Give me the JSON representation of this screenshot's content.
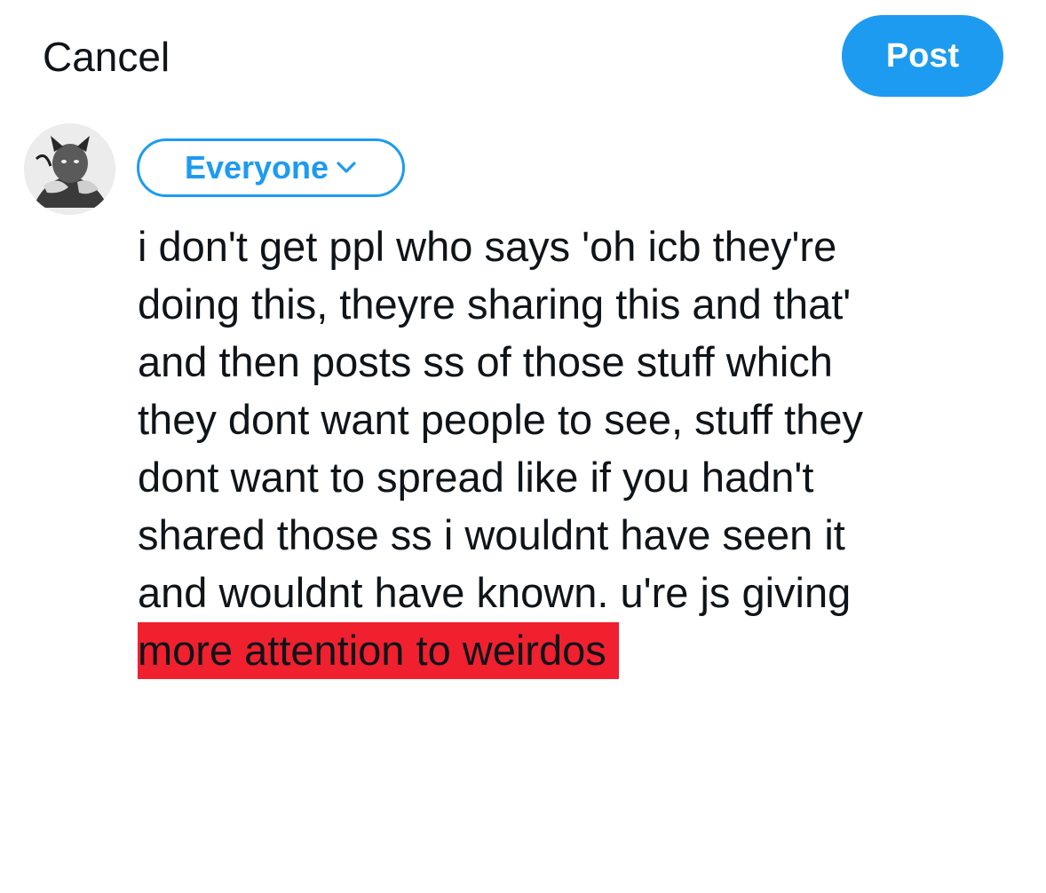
{
  "header": {
    "cancel_label": "Cancel",
    "post_label": "Post"
  },
  "colors": {
    "accent": "#1d9bf0",
    "highlight": "#f0202f",
    "text": "#0f1419"
  },
  "composer": {
    "audience_label": "Everyone",
    "audience_icon": "chevron-down-icon",
    "avatar_icon": "user-avatar",
    "text_lines": [
      "i don't get ppl who says 'oh icb they're",
      "doing this, theyre sharing this and that'",
      "and then posts ss of those stuff which",
      "they dont want people to see, stuff they",
      "dont want to spread like if you hadn't",
      "shared those ss i wouldnt have seen it",
      "and wouldnt have known. u're js giving"
    ],
    "highlighted_line": "more attention to weirdos"
  }
}
